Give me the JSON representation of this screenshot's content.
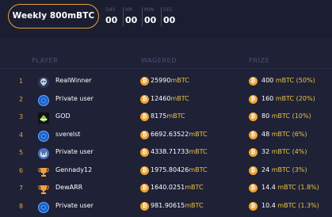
{
  "header": {
    "period_label": "Weekly 800mBTC",
    "timer": [
      {
        "label": "DAY",
        "value": "00"
      },
      {
        "label": "HR",
        "value": "00"
      },
      {
        "label": "MIN",
        "value": "00"
      },
      {
        "label": "SEC",
        "value": "00"
      }
    ]
  },
  "table": {
    "columns": {
      "player": "PLAYER",
      "wagered": "WAGERED",
      "prize": "PRIZE"
    },
    "rows": [
      {
        "rank": "1",
        "avatar": "skull-avatar-icon",
        "name": "RealWinner",
        "wagered": "25990",
        "wagered_unit": "mBTC",
        "prize": "400",
        "prize_unit": "mBTC",
        "prize_pct": "(50%)"
      },
      {
        "rank": "2",
        "avatar": "gear-avatar-icon",
        "name": "Private user",
        "wagered": "12460",
        "wagered_unit": "mBTC",
        "prize": "160",
        "prize_unit": "mBTC",
        "prize_pct": "(20%)"
      },
      {
        "rank": "3",
        "avatar": "god-logo-avatar",
        "name": "GOD",
        "wagered": "8175",
        "wagered_unit": "mBTC",
        "prize": "80",
        "prize_unit": "mBTC",
        "prize_pct": "(10%)"
      },
      {
        "rank": "4",
        "avatar": "gear-avatar-icon",
        "name": "sverelst",
        "wagered": "6692.63522",
        "wagered_unit": "mBTC",
        "prize": "48",
        "prize_unit": "mBTC",
        "prize_pct": "(6%)"
      },
      {
        "rank": "5",
        "avatar": "cat-avatar-icon",
        "name": "Private user",
        "wagered": "4338.71733",
        "wagered_unit": "mBTC",
        "prize": "32",
        "prize_unit": "mBTC",
        "prize_pct": "(4%)"
      },
      {
        "rank": "6",
        "avatar": "trophy-avatar-icon",
        "name": "Gennady12",
        "wagered": "1975.80426",
        "wagered_unit": "mBTC",
        "prize": "24",
        "prize_unit": "mBTC",
        "prize_pct": "(3%)"
      },
      {
        "rank": "7",
        "avatar": "trophy-avatar-icon",
        "name": "DewARR",
        "wagered": "1640.0251",
        "wagered_unit": "mBTC",
        "prize": "14.4",
        "prize_unit": "mBTC",
        "prize_pct": "(1.8%)"
      },
      {
        "rank": "8",
        "avatar": "gear-avatar-icon",
        "name": "Private user",
        "wagered": "981.90615",
        "wagered_unit": "mBTC",
        "prize": "10.4",
        "prize_unit": "mBTC",
        "prize_pct": "(1.3%)"
      }
    ]
  },
  "coin_symbol": "₿",
  "colors": {
    "accent": "#e8a33a",
    "unit": "#e8c440",
    "background": "#1f2137"
  }
}
